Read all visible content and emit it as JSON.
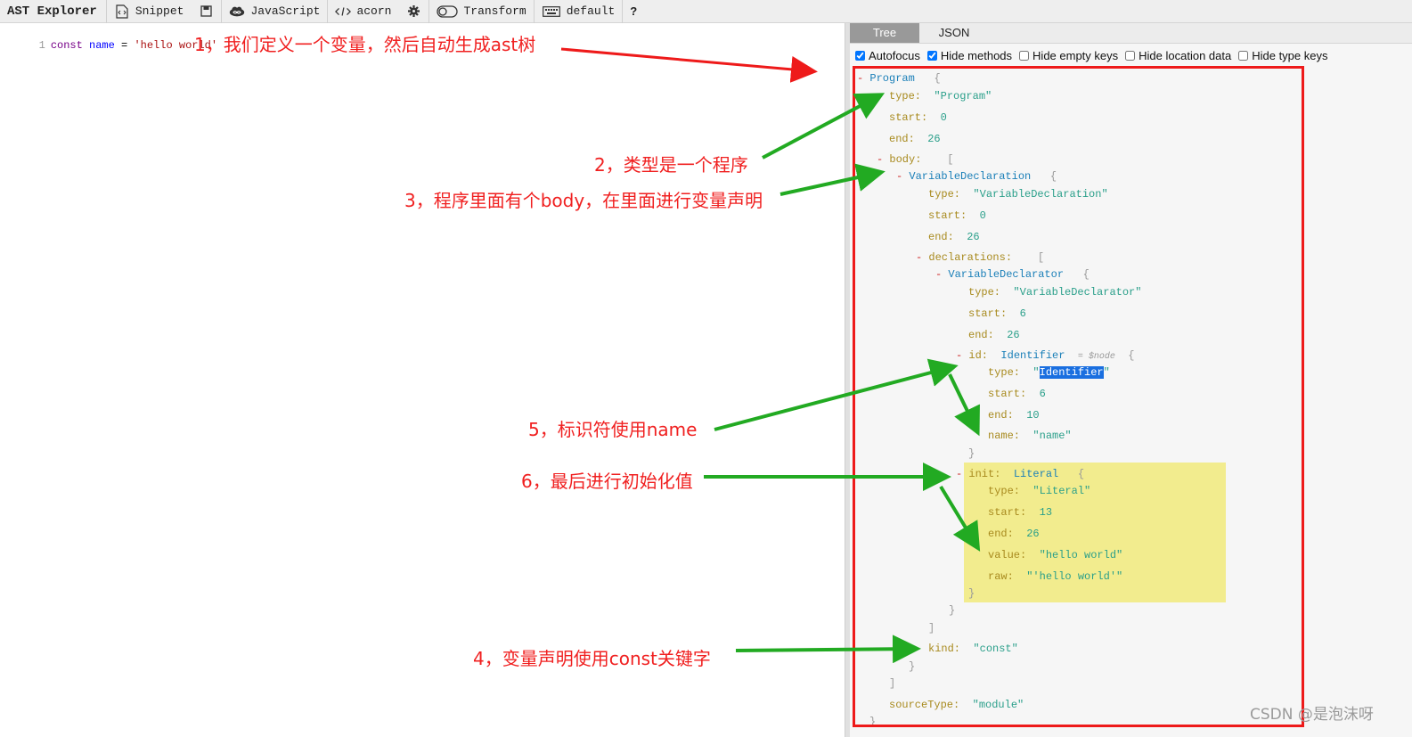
{
  "toolbar": {
    "title": "AST Explorer",
    "snippet_label": "Snippet",
    "language_label": "JavaScript",
    "parser_label": "acorn",
    "transform_label": "Transform",
    "keymap_label": "default",
    "help_label": "?"
  },
  "editor": {
    "line_number": "1",
    "code": {
      "kw": "const",
      "name": "name",
      "op": " = ",
      "str": "'hello world'"
    }
  },
  "tabs": {
    "tree": "Tree",
    "json": "JSON"
  },
  "options": [
    {
      "label": "Autofocus",
      "checked": true
    },
    {
      "label": "Hide methods",
      "checked": true
    },
    {
      "label": "Hide empty keys",
      "checked": false
    },
    {
      "label": "Hide location data",
      "checked": false
    },
    {
      "label": "Hide type keys",
      "checked": false
    }
  ],
  "tree": {
    "program": "Program",
    "k_type": "type:",
    "k_start": "start:",
    "k_end": "end:",
    "k_body": "body:",
    "k_declarations": "declarations:",
    "k_id": "id:",
    "k_name": "name:",
    "k_init": "init:",
    "k_value": "value:",
    "k_raw": "raw:",
    "k_kind": "kind:",
    "k_sourceType": "sourceType:",
    "v_program": "\"Program\"",
    "v_0": "0",
    "v_26": "26",
    "v_6": "6",
    "v_10": "10",
    "v_13": "13",
    "vardecl": "VariableDeclaration",
    "v_vardecl": "\"VariableDeclaration\"",
    "vardeclarator": "VariableDeclarator",
    "v_vardeclarator": "\"VariableDeclarator\"",
    "identifier": "Identifier",
    "v_identifier": "Identifier",
    "node_ref": "$node",
    "v_name": "\"name\"",
    "literal": "Literal",
    "v_literal": "\"Literal\"",
    "v_hello": "\"hello world\"",
    "v_raw": "\"'hello world'\"",
    "v_const": "\"const\"",
    "v_module": "\"module\""
  },
  "annotations": {
    "a1": "1，我们定义一个变量，然后自动生成ast树",
    "a2": "2，类型是一个程序",
    "a3": "3，程序里面有个body，在里面进行变量声明",
    "a4": "4，变量声明使用const关键字",
    "a5": "5，标识符使用name",
    "a6": "6，最后进行初始化值"
  },
  "watermark": "CSDN @是泡沫呀",
  "colors": {
    "annotation": "#f02020",
    "arrow": "#22aa22",
    "frame": "#ee1a1a",
    "highlight": "#f2ec8e"
  }
}
